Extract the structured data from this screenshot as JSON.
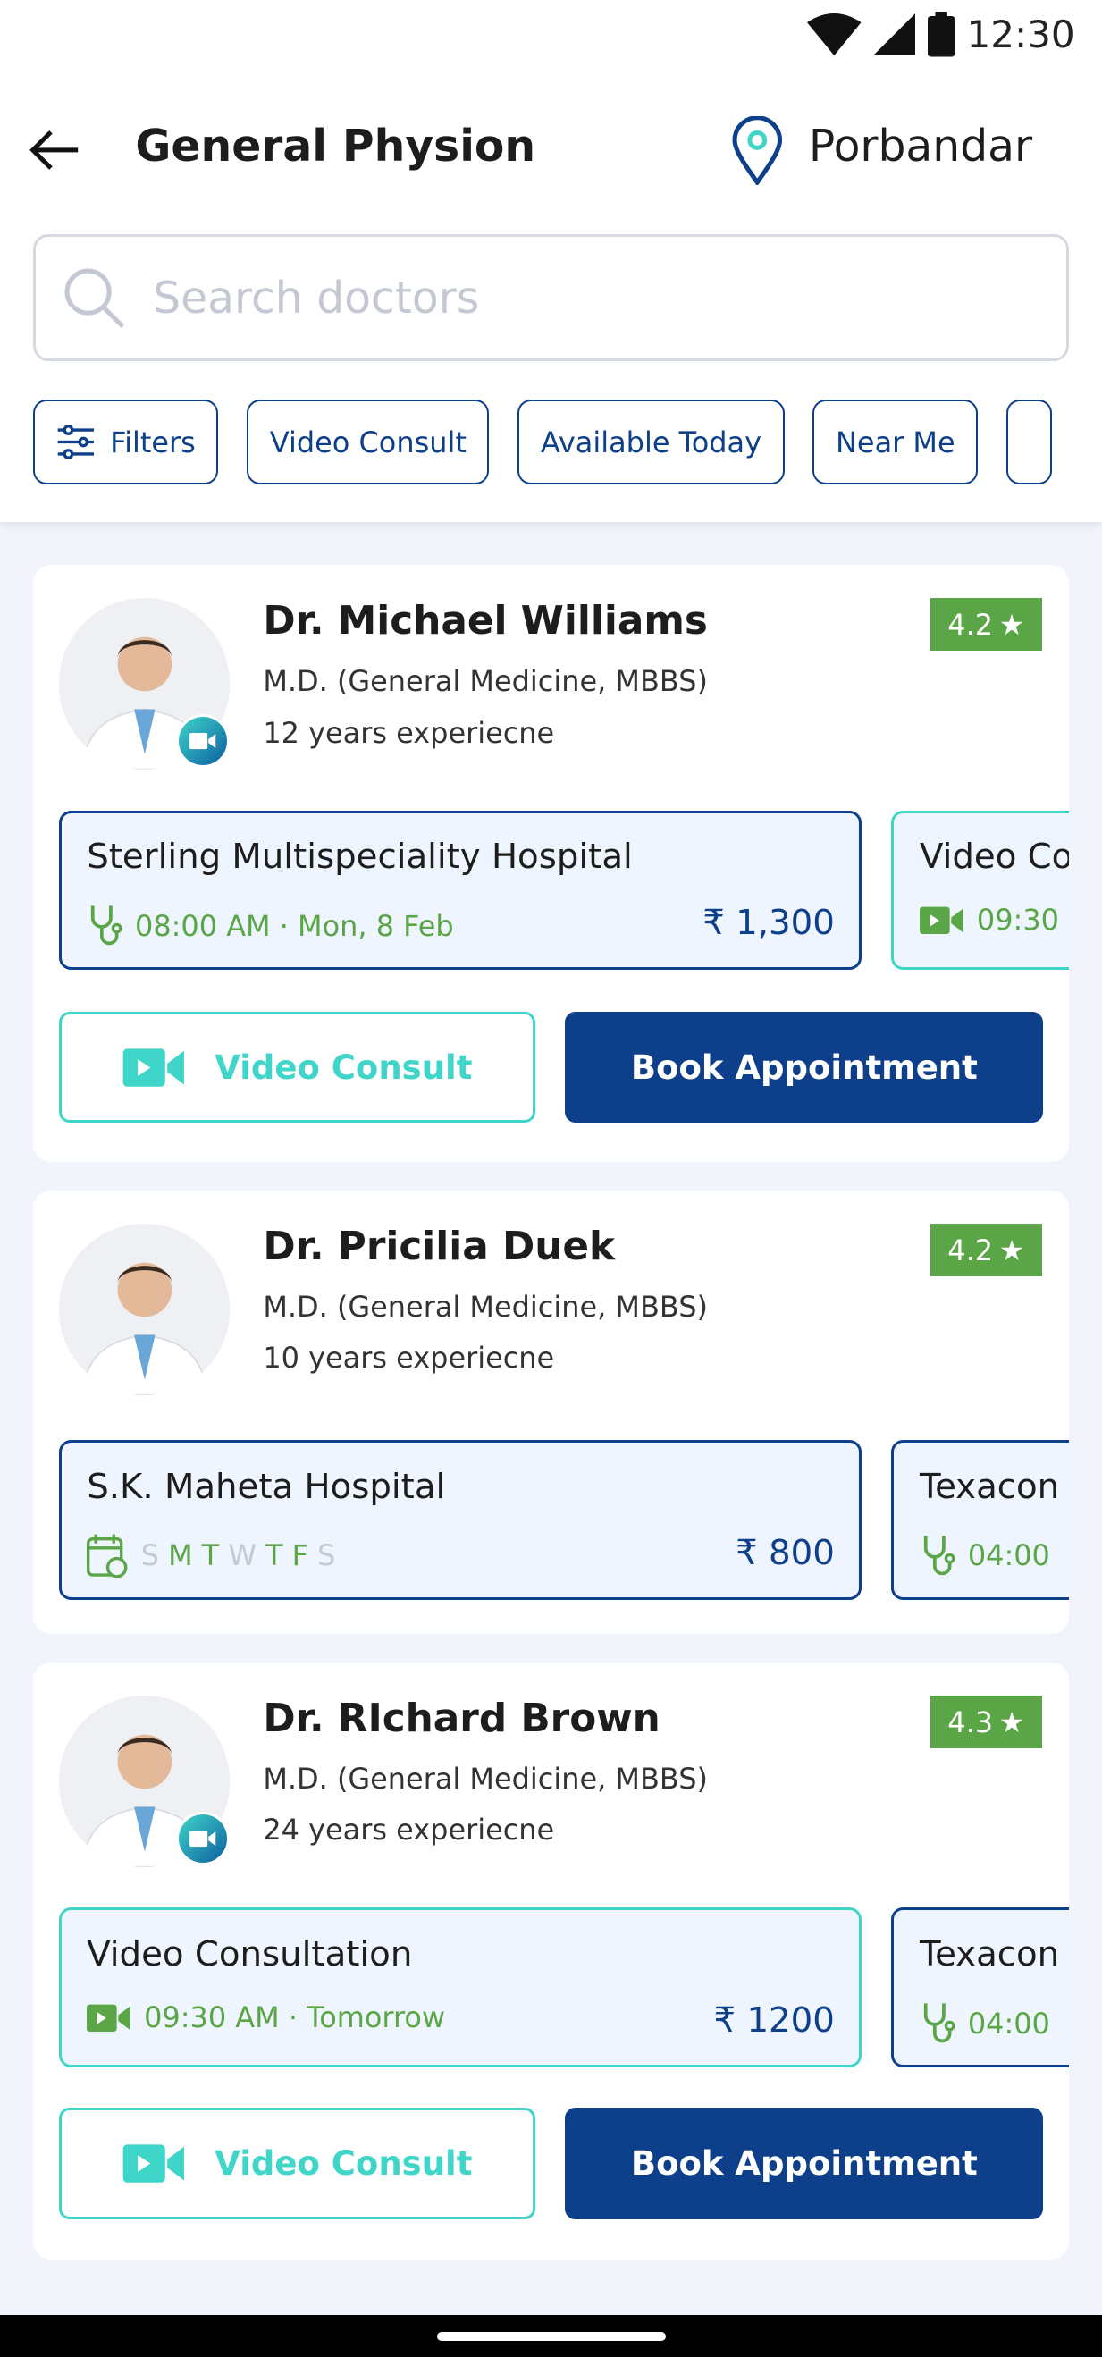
{
  "status_bar": {
    "time": "12:30"
  },
  "header": {
    "title": "General Physion",
    "location": "Porbandar"
  },
  "search": {
    "placeholder": "Search doctors",
    "value": ""
  },
  "chips": [
    {
      "label": "Filters",
      "icon": "sliders-icon"
    },
    {
      "label": "Video Consult"
    },
    {
      "label": "Available Today"
    },
    {
      "label": "Near Me"
    }
  ],
  "colors": {
    "primary": "#0d3f8a",
    "teal": "#3fd5c9",
    "green": "#5aa545",
    "slot_bg": "#eef5fe"
  },
  "doctors": [
    {
      "name": "Dr. Michael Williams",
      "degree": "M.D. (General Medicine, MBBS)",
      "experience": "12 years experiecne",
      "rating": "4.2",
      "video": true,
      "slots": [
        {
          "name": "Sterling Multispeciality Hospital",
          "info": "08:00 AM · Mon, 8 Feb",
          "fee": "₹ 1,300",
          "icon": "stethoscope-icon"
        },
        {
          "name": "Video Co",
          "info": "09:30",
          "icon": "video-icon"
        }
      ],
      "video_button": "Video Consult",
      "book_button": "Book Appointment"
    },
    {
      "name": "Dr. Pricilia Duek",
      "degree": "M.D. (General Medicine, MBBS)",
      "experience": "10 years experiecne",
      "rating": "4.2",
      "video": false,
      "slots": [
        {
          "name": "S.K. Maheta Hospital",
          "days": [
            {
              "d": "S",
              "on": false
            },
            {
              "d": "M",
              "on": true
            },
            {
              "d": "T",
              "on": true
            },
            {
              "d": "W",
              "on": false
            },
            {
              "d": "T",
              "on": true
            },
            {
              "d": "F",
              "on": true
            },
            {
              "d": "S",
              "on": false
            }
          ],
          "fee": "₹ 800",
          "icon": "calendar-clock-icon"
        },
        {
          "name": "Texacon",
          "info": "04:00",
          "icon": "stethoscope-icon"
        }
      ]
    },
    {
      "name": "Dr. RIchard Brown",
      "degree": "M.D. (General Medicine, MBBS)",
      "experience": "24 years experiecne",
      "rating": "4.3",
      "video": true,
      "slots": [
        {
          "name": "Video Consultation",
          "info": "09:30 AM · Tomorrow",
          "fee": "₹ 1200",
          "icon": "video-icon"
        },
        {
          "name": "Texacon",
          "info": "04:00",
          "icon": "stethoscope-icon"
        }
      ],
      "video_button": "Video Consult",
      "book_button": "Book Appointment"
    }
  ]
}
